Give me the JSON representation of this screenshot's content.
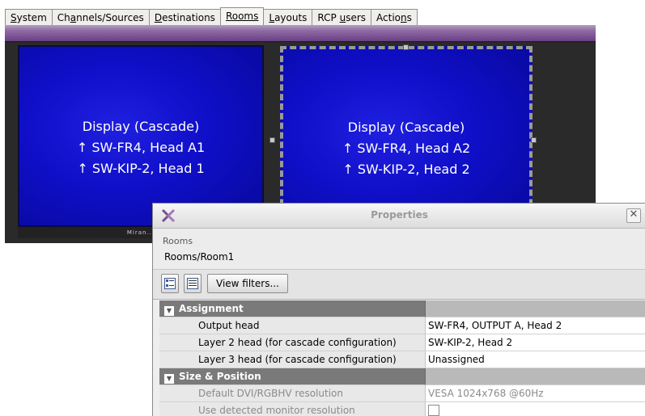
{
  "tabs": [
    {
      "label": "System",
      "accel": "S",
      "rest": "ystem"
    },
    {
      "label": "Channels/Sources",
      "pre": "Ch",
      "accel": "a",
      "rest": "nnels/Sources"
    },
    {
      "label": "Destinations",
      "accel": "D",
      "rest": "estinations"
    },
    {
      "label": "Rooms",
      "accel": "R",
      "rest": "ooms",
      "active": true
    },
    {
      "label": "Layouts",
      "accel": "L",
      "rest": "ayouts"
    },
    {
      "label": "RCP users",
      "pre": "RCP ",
      "accel": "u",
      "rest": "sers"
    },
    {
      "label": "Actions",
      "pre": "Actio",
      "accel": "n",
      "rest": "s"
    }
  ],
  "displays": [
    {
      "line1": "Display (Cascade)",
      "line2": "↑ SW-FR4, Head A1",
      "line3": "↑ SW-KIP-2, Head 1",
      "bezel": "Miran..."
    },
    {
      "line1": "Display (Cascade)",
      "line2": "↑ SW-FR4, Head A2",
      "line3": "↑ SW-KIP-2, Head 2"
    }
  ],
  "properties": {
    "title": "Properties",
    "close_icon": "close-icon",
    "crumb_label": "Rooms",
    "crumb_path": "Rooms/Room1",
    "view_filters_label": "View filters...",
    "sections": [
      {
        "name": "Assignment",
        "rows": [
          {
            "name": "Output head",
            "value": "SW-FR4, OUTPUT A, Head 2"
          },
          {
            "name": "Layer 2 head (for cascade configuration)",
            "value": "SW-KIP-2, Head 2"
          },
          {
            "name": "Layer 3 head (for cascade configuration)",
            "value": "Unassigned"
          }
        ]
      },
      {
        "name": "Size & Position",
        "rows": [
          {
            "name": "Default DVI/RGBHV resolution",
            "value": "VESA 1024x768 @60Hz",
            "disabled": true
          },
          {
            "name": "Use detected monitor resolution",
            "value": "",
            "checkbox": true,
            "disabled": true
          }
        ]
      }
    ]
  }
}
